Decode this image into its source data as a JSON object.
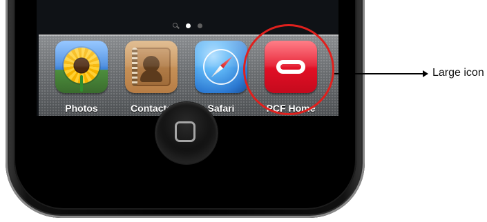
{
  "dock": {
    "apps": [
      {
        "label": "Photos",
        "icon": "photos-icon"
      },
      {
        "label": "Contacts",
        "icon": "contacts-icon"
      },
      {
        "label": "Safari",
        "icon": "safari-icon"
      },
      {
        "label": "PCF Home",
        "icon": "pcf-home-icon"
      }
    ]
  },
  "callout": {
    "label": "Large icon"
  },
  "page_indicator": {
    "search_icon": "search-icon",
    "active_page": 1,
    "page_count": 2
  },
  "colors": {
    "highlight_ring": "#e0201d",
    "pcf_icon_red": "#e00f25"
  }
}
